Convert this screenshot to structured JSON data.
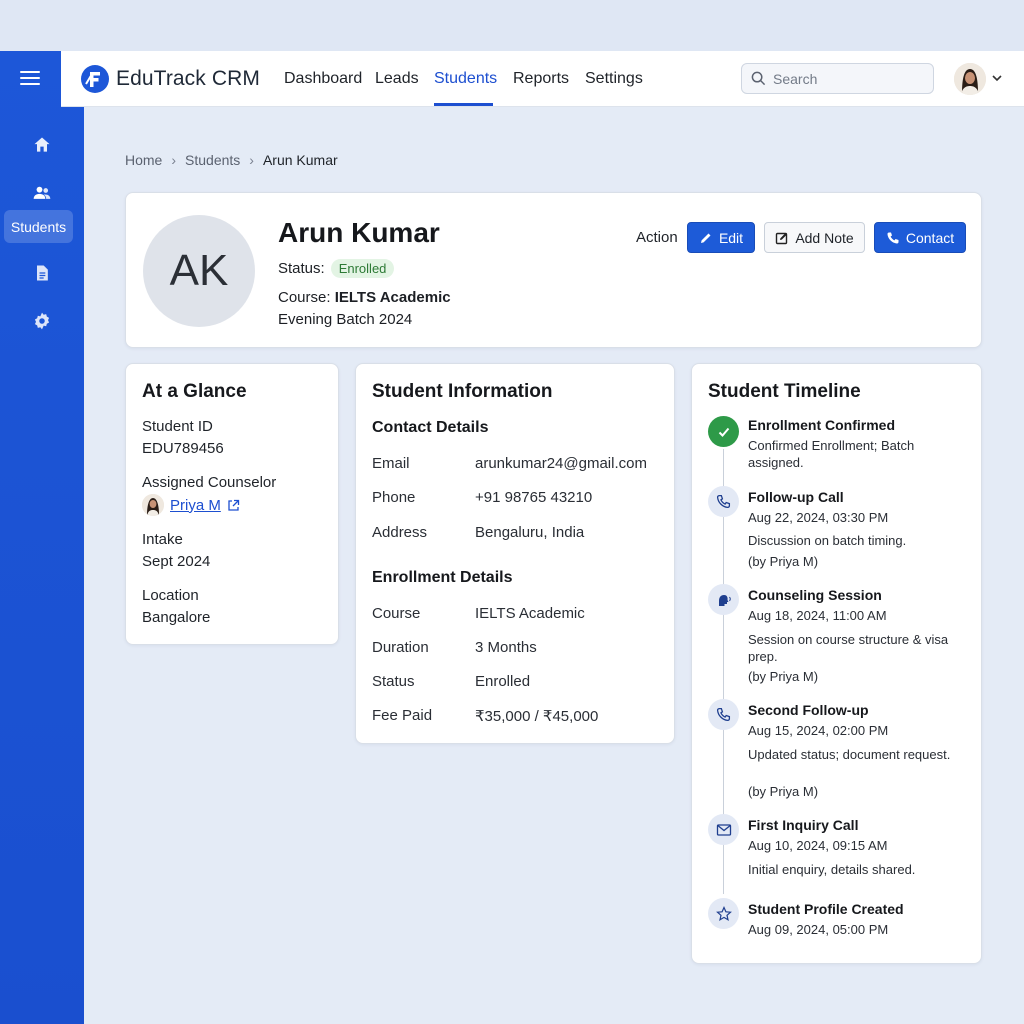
{
  "app": {
    "brand": "EduTrack CRM",
    "accent": "#1d4fd0",
    "sidebar_color": "#1d57d8"
  },
  "nav": {
    "items": [
      {
        "label": "Dashboard",
        "active": false
      },
      {
        "label": "Leads",
        "active": false
      },
      {
        "label": "Students",
        "active": true
      },
      {
        "label": "Reports",
        "active": false
      },
      {
        "label": "Settings",
        "active": false
      }
    ],
    "search_placeholder": "Search"
  },
  "sidebar": {
    "items": [
      {
        "icon": "home-icon"
      },
      {
        "icon": "users-icon",
        "label": "Students",
        "active": true
      },
      {
        "icon": "document-icon"
      },
      {
        "icon": "gear-icon"
      }
    ]
  },
  "breadcrumb": [
    "Home",
    "Students",
    "Arun Kumar"
  ],
  "profile": {
    "initials": "AK",
    "name": "Arun Kumar",
    "status_label": "Status:",
    "status": "Enrolled",
    "course_label": "Course:",
    "course": "IELTS Academic",
    "batch": "Evening Batch 2024",
    "action_label": "Action",
    "buttons": {
      "edit": "Edit",
      "add_note": "Add Note",
      "contact": "Contact"
    }
  },
  "glance": {
    "title": "At a Glance",
    "student_id_label": "Student ID",
    "student_id": "EDU789456",
    "counselor_label": "Assigned Counselor",
    "counselor": "Priya M",
    "intake_label": "Intake",
    "intake": "Sept 2024",
    "location_label": "Location",
    "location": "Bangalore"
  },
  "info": {
    "title": "Student Information",
    "contact_title": "Contact Details",
    "contact": [
      {
        "label": "Email",
        "value": "arunkumar24@gmail.com"
      },
      {
        "label": "Phone",
        "value": "+91 98765 43210"
      },
      {
        "label": "Address",
        "value": "Bengaluru, India"
      }
    ],
    "enrollment_title": "Enrollment Details",
    "enrollment": [
      {
        "label": "Course",
        "value": "IELTS Academic"
      },
      {
        "label": "Duration",
        "value": "3 Months"
      },
      {
        "label": "Status",
        "value": "Enrolled"
      },
      {
        "label": "Fee Paid",
        "value": "₹35,000 / ₹45,000"
      }
    ]
  },
  "timeline": {
    "title": "Student Timeline",
    "events": [
      {
        "icon": "check-icon",
        "title": "Enrollment Confirmed",
        "lines": [
          "Confirmed Enrollment; Batch",
          "assigned."
        ]
      },
      {
        "icon": "phone-icon",
        "title": "Follow-up Call",
        "date": "Aug 22, 2024, 03:30 PM",
        "lines": [
          "Discussion on batch timing.",
          "(by Priya M)"
        ]
      },
      {
        "icon": "speaking-head-icon",
        "title": "Counseling Session",
        "date": "Aug 18, 2024, 11:00 AM",
        "lines": [
          "Session on course structure & visa",
          "prep.",
          "(by Priya M)"
        ]
      },
      {
        "icon": "phone-icon",
        "title": "Second Follow-up",
        "date": "Aug 15, 2024, 02:00 PM",
        "lines": [
          "Updated status; document request.",
          "(by Priya M)"
        ]
      },
      {
        "icon": "mail-icon",
        "title": "First Inquiry Call",
        "date": "Aug 10, 2024, 09:15 AM",
        "lines": [
          "Initial enquiry, details shared."
        ]
      },
      {
        "icon": "star-icon",
        "title": "Student Profile Created",
        "date": "Aug 09, 2024, 05:00 PM",
        "lines": []
      }
    ]
  }
}
